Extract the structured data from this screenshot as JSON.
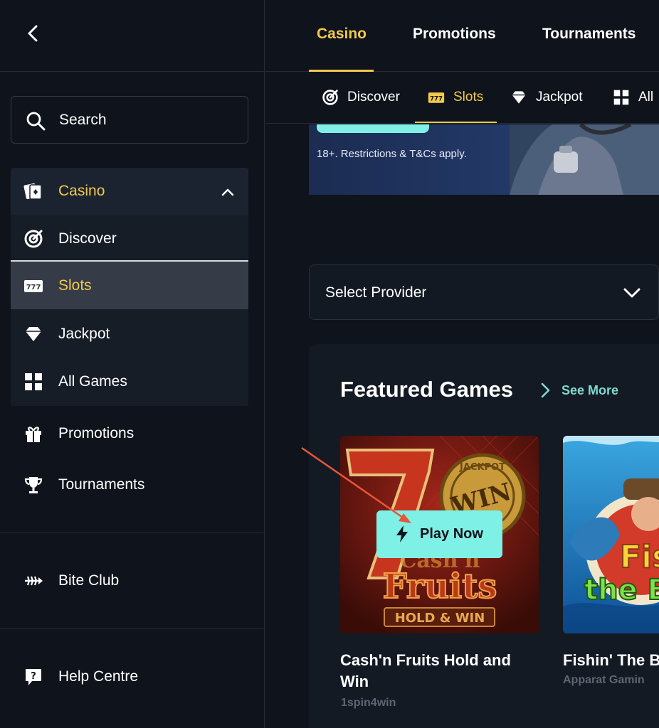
{
  "sidebar": {
    "search_label": "Search",
    "casino_label": "Casino",
    "casino_sub": [
      {
        "label": "Discover",
        "icon": "target-icon"
      },
      {
        "label": "Slots",
        "icon": "slot-machine-icon"
      },
      {
        "label": "Jackpot",
        "icon": "diamond-icon"
      },
      {
        "label": "All Games",
        "icon": "grid-icon"
      }
    ],
    "promotions_label": "Promotions",
    "tournaments_label": "Tournaments",
    "biteclub_label": "Bite Club",
    "help_label": "Help Centre"
  },
  "topnav": {
    "tabs": [
      "Casino",
      "Promotions",
      "Tournaments"
    ]
  },
  "subnav": {
    "tabs": [
      {
        "label": "Discover",
        "icon": "target-icon"
      },
      {
        "label": "Slots",
        "icon": "slot-machine-icon"
      },
      {
        "label": "Jackpot",
        "icon": "diamond-icon"
      },
      {
        "label": "All",
        "icon": "grid-icon"
      }
    ]
  },
  "banner": {
    "terms": "18+. Restrictions & T&Cs apply."
  },
  "provider": {
    "label": "Select Provider"
  },
  "featured": {
    "title": "Featured Games",
    "see_more": "See More",
    "play_now": "Play Now",
    "games": [
      {
        "name_line1": "Cash'n Fruits Hold and",
        "name_line2": "Win",
        "provider": "1spin4win",
        "art_text": [
          "Cash'n",
          "Fruits",
          "HOLD & WIN",
          "JACKPOT",
          "WIN"
        ]
      },
      {
        "name_line1": "Fishin' The B",
        "provider": "Apparat Gamin",
        "art_text": [
          "Fish",
          "the Bi"
        ]
      }
    ]
  },
  "colors": {
    "accent": "#f2c94c",
    "cta": "#7ff0e6",
    "bg": "#0f141c"
  }
}
